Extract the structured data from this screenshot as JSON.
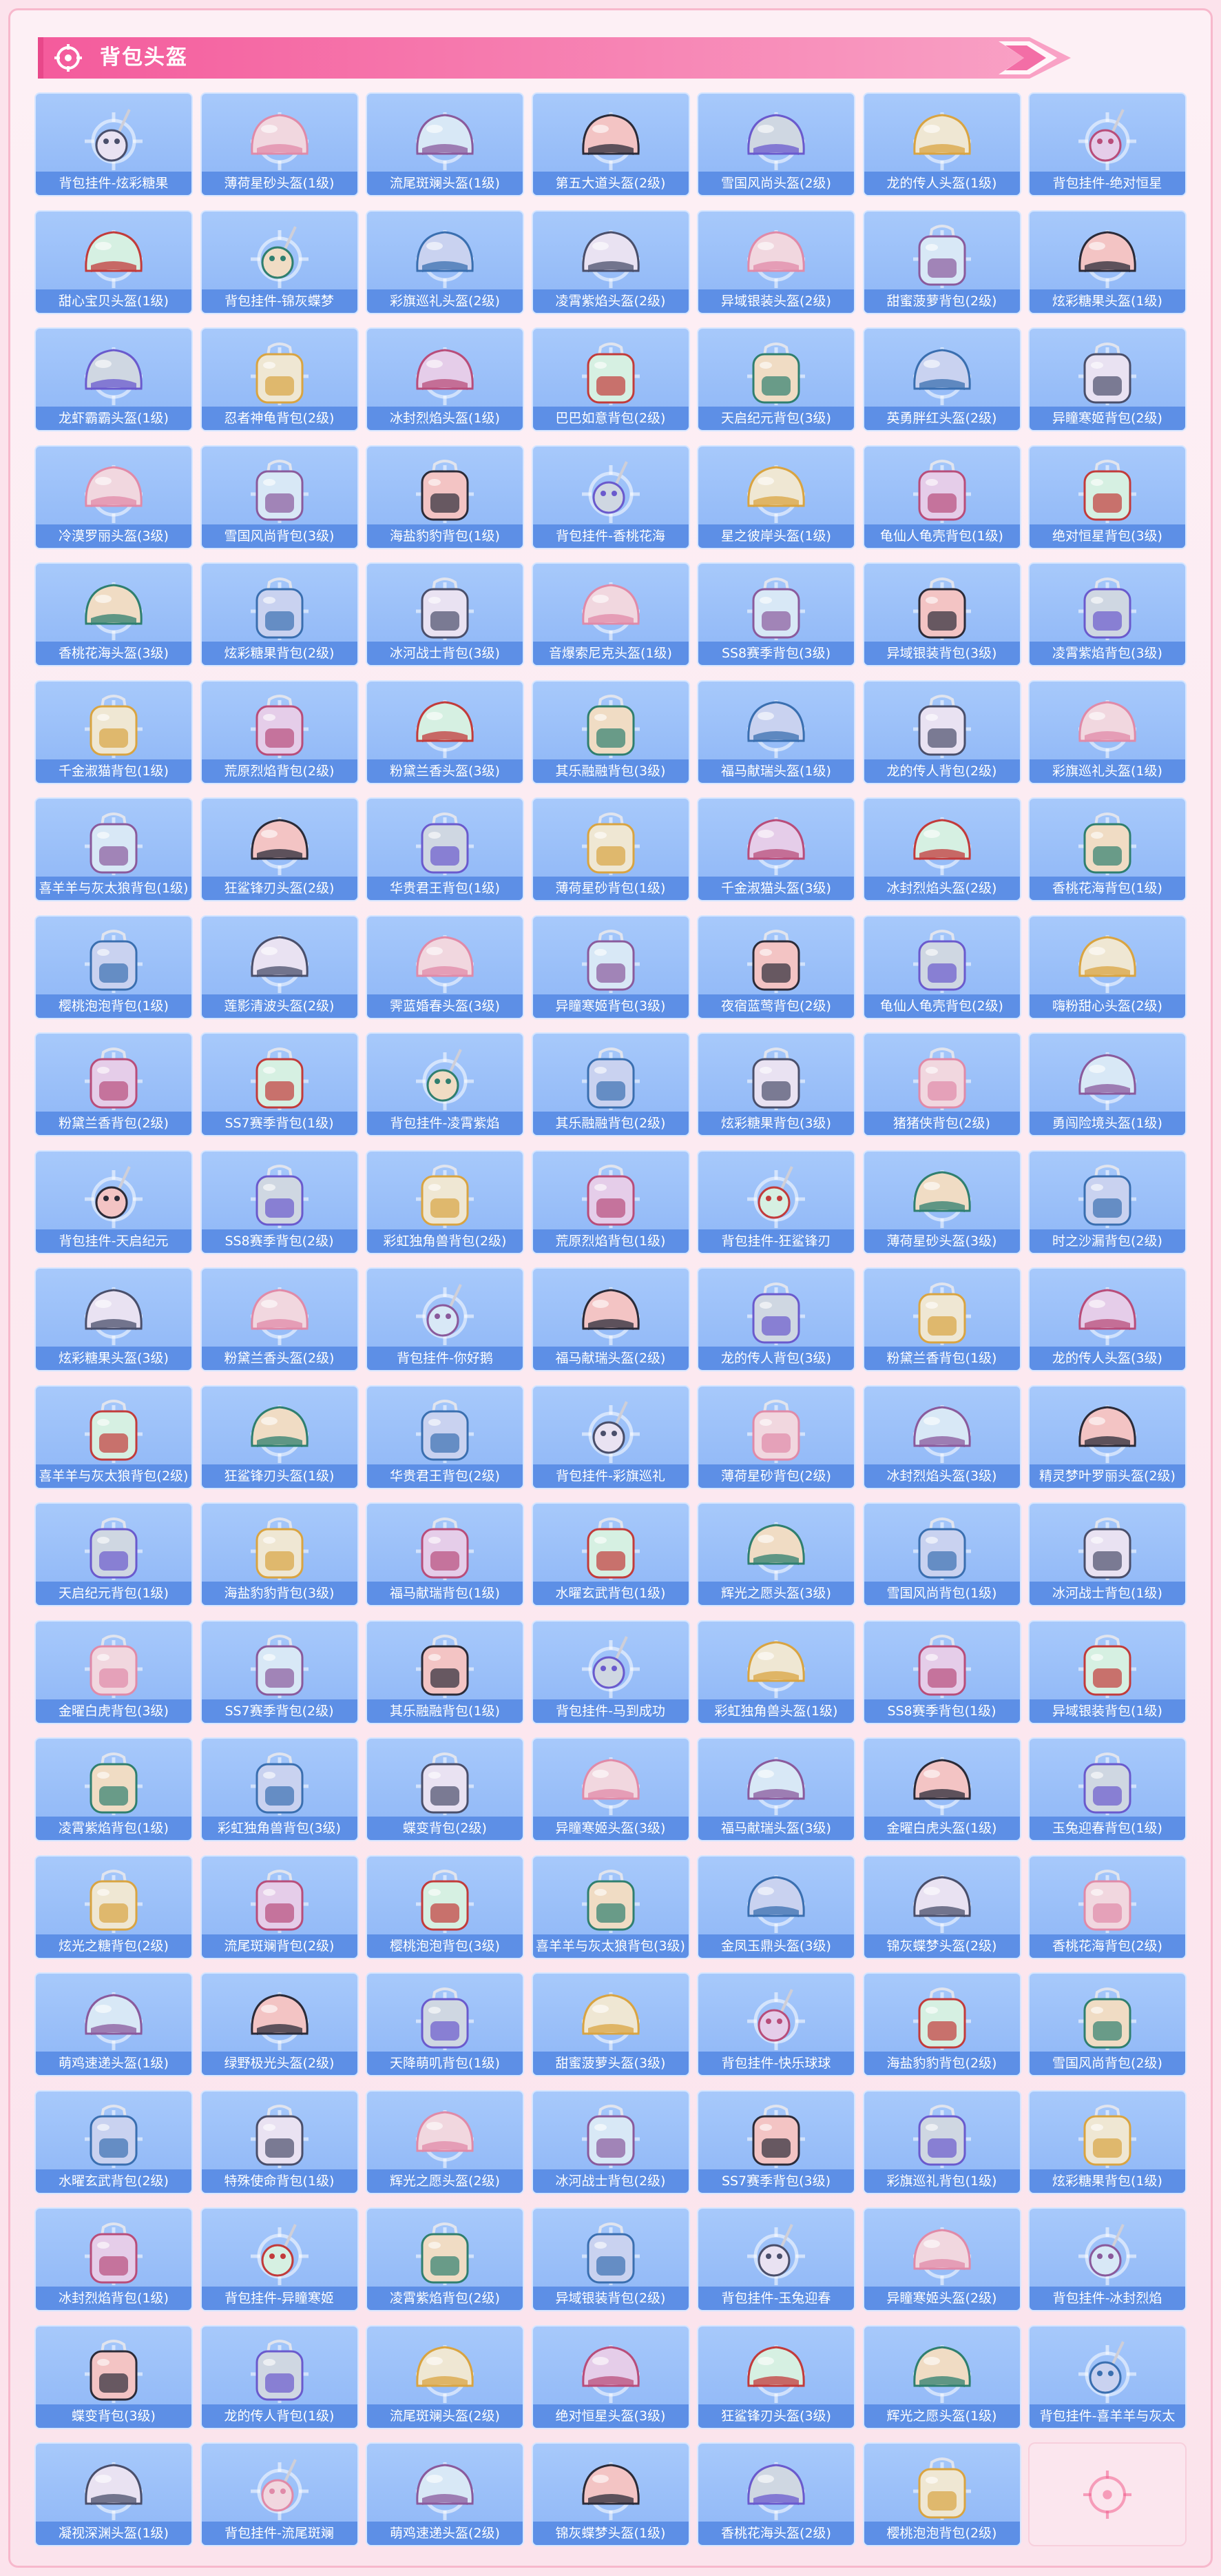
{
  "header": {
    "title": "背包头盔"
  },
  "colors": {
    "tile_bg": "#9bbff8",
    "label_bg": "#5d8fe6",
    "banner": "#f36ea6",
    "page_bg": "#fce3ec",
    "target_ring": "#f25e8e"
  },
  "items": [
    "背包挂件-炫彩糖果",
    "薄荷星砂头盔(1级)",
    "流尾斑斓头盔(1级)",
    "第五大道头盔(2级)",
    "雪国风尚头盔(2级)",
    "龙的传人头盔(1级)",
    "背包挂件-绝对恒星",
    "甜心宝贝头盔(1级)",
    "背包挂件-锦灰蝶梦",
    "彩旗巡礼头盔(2级)",
    "凌霄紫焰头盔(2级)",
    "异域银装头盔(2级)",
    "甜蜜菠萝背包(2级)",
    "炫彩糖果头盔(1级)",
    "龙虾霸霸头盔(1级)",
    "忍者神龟背包(2级)",
    "冰封烈焰头盔(1级)",
    "巴巴如意背包(2级)",
    "天启纪元背包(3级)",
    "英勇胖红头盔(2级)",
    "异瞳寒姬背包(2级)",
    "冷漠罗丽头盔(3级)",
    "雪国风尚背包(3级)",
    "海盐豹豹背包(1级)",
    "背包挂件-香桃花海",
    "星之彼岸头盔(1级)",
    "龟仙人龟壳背包(1级)",
    "绝对恒星背包(3级)",
    "香桃花海头盔(3级)",
    "炫彩糖果背包(2级)",
    "冰河战士背包(3级)",
    "音爆索尼克头盔(1级)",
    "SS8赛季背包(3级)",
    "异域银装背包(3级)",
    "凌霄紫焰背包(3级)",
    "千金淑猫背包(1级)",
    "荒原烈焰背包(2级)",
    "粉黛兰香头盔(3级)",
    "其乐融融背包(3级)",
    "福马献瑞头盔(1级)",
    "龙的传人背包(2级)",
    "彩旗巡礼头盔(1级)",
    "喜羊羊与灰太狼背包(1级)",
    "狂鲨锋刃头盔(2级)",
    "华贵君王背包(1级)",
    "薄荷星砂背包(1级)",
    "千金淑猫头盔(3级)",
    "冰封烈焰头盔(2级)",
    "香桃花海背包(1级)",
    "樱桃泡泡背包(1级)",
    "莲影清波头盔(2级)",
    "霁蓝婚春头盔(3级)",
    "异瞳寒姬背包(3级)",
    "夜宿蓝莺背包(2级)",
    "龟仙人龟壳背包(2级)",
    "嗨粉甜心头盔(2级)",
    "粉黛兰香背包(2级)",
    "SS7赛季背包(1级)",
    "背包挂件-凌霄紫焰",
    "其乐融融背包(2级)",
    "炫彩糖果背包(3级)",
    "猪猪侠背包(2级)",
    "勇闯险境头盔(1级)",
    "背包挂件-天启纪元",
    "SS8赛季背包(2级)",
    "彩虹独角兽背包(2级)",
    "荒原烈焰背包(1级)",
    "背包挂件-狂鲨锋刃",
    "薄荷星砂头盔(3级)",
    "时之沙漏背包(2级)",
    "炫彩糖果头盔(3级)",
    "粉黛兰香头盔(2级)",
    "背包挂件-你好鹅",
    "福马献瑞头盔(2级)",
    "龙的传人背包(3级)",
    "粉黛兰香背包(1级)",
    "龙的传人头盔(3级)",
    "喜羊羊与灰太狼背包(2级)",
    "狂鲨锋刃头盔(1级)",
    "华贵君王背包(2级)",
    "背包挂件-彩旗巡礼",
    "薄荷星砂背包(2级)",
    "冰封烈焰头盔(3级)",
    "精灵梦叶罗丽头盔(2级)",
    "天启纪元背包(1级)",
    "海盐豹豹背包(3级)",
    "福马献瑞背包(1级)",
    "水曜玄武背包(1级)",
    "辉光之愿头盔(3级)",
    "雪国风尚背包(1级)",
    "冰河战士背包(1级)",
    "金曜白虎背包(3级)",
    "SS7赛季背包(2级)",
    "其乐融融背包(1级)",
    "背包挂件-马到成功",
    "彩虹独角兽头盔(1级)",
    "SS8赛季背包(1级)",
    "异域银装背包(1级)",
    "凌霄紫焰背包(1级)",
    "彩虹独角兽背包(3级)",
    "蝶变背包(2级)",
    "异瞳寒姬头盔(3级)",
    "福马献瑞头盔(3级)",
    "金曜白虎头盔(1级)",
    "玉兔迎春背包(1级)",
    "炫光之糖背包(2级)",
    "流尾斑斓背包(2级)",
    "樱桃泡泡背包(3级)",
    "喜羊羊与灰太狼背包(3级)",
    "金凤玉鼎头盔(3级)",
    "锦灰蝶梦头盔(2级)",
    "香桃花海背包(2级)",
    "萌鸡速递头盔(1级)",
    "绿野极光头盔(2级)",
    "天降萌叽背包(1级)",
    "甜蜜菠萝头盔(3级)",
    "背包挂件-快乐球球",
    "海盐豹豹背包(2级)",
    "雪国风尚背包(2级)",
    "水曜玄武背包(2级)",
    "特殊使命背包(1级)",
    "辉光之愿头盔(2级)",
    "冰河战士背包(2级)",
    "SS7赛季背包(3级)",
    "彩旗巡礼背包(1级)",
    "炫彩糖果背包(1级)",
    "冰封烈焰背包(1级)",
    "背包挂件-异瞳寒姬",
    "凌霄紫焰背包(2级)",
    "异域银装背包(2级)",
    "背包挂件-玉兔迎春",
    "异瞳寒姬头盔(2级)",
    "背包挂件-冰封烈焰",
    "蝶变背包(3级)",
    "龙的传人背包(1级)",
    "流尾斑斓头盔(2级)",
    "绝对恒星头盔(3级)",
    "狂鲨锋刃头盔(3级)",
    "辉光之愿头盔(1级)",
    "背包挂件-喜羊羊与灰太",
    "凝视深渊头盔(1级)",
    "背包挂件-流尾斑斓",
    "萌鸡速递头盔(2级)",
    "锦灰蝶梦头盔(1级)",
    "香桃花海头盔(2级)",
    "樱桃泡泡背包(2级)"
  ]
}
